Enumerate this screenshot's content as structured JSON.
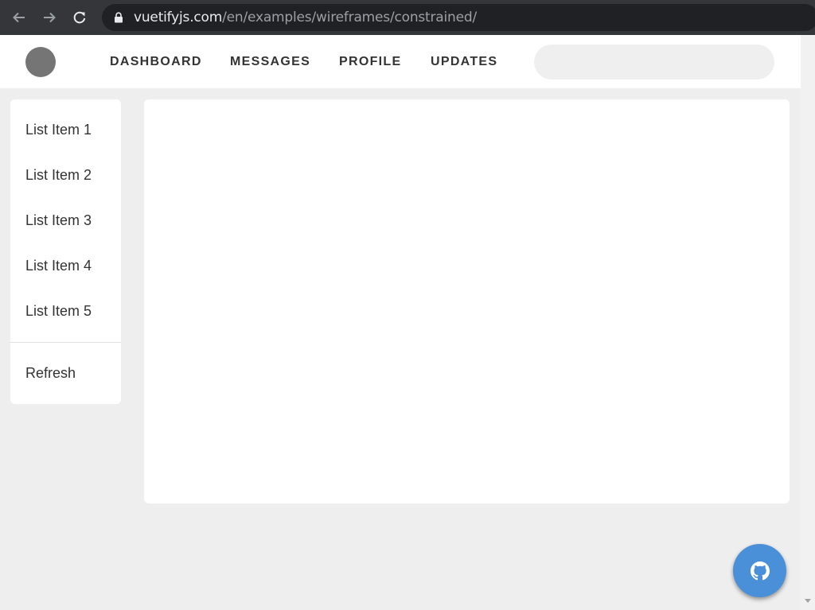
{
  "browser": {
    "url_host": "vuetifyjs.com",
    "url_path": "/en/examples/wireframes/constrained/",
    "icons": {
      "back": "arrow-left-icon",
      "forward": "arrow-right-icon",
      "reload": "reload-icon",
      "lock": "lock-icon"
    }
  },
  "app_bar": {
    "tabs": [
      {
        "label": "DASHBOARD"
      },
      {
        "label": "MESSAGES"
      },
      {
        "label": "PROFILE"
      },
      {
        "label": "UPDATES"
      }
    ],
    "search": {
      "value": "",
      "placeholder": ""
    }
  },
  "sidebar": {
    "items": [
      {
        "label": "List Item 1"
      },
      {
        "label": "List Item 2"
      },
      {
        "label": "List Item 3"
      },
      {
        "label": "List Item 4"
      },
      {
        "label": "List Item 5"
      }
    ],
    "refresh_label": "Refresh"
  },
  "fab": {
    "icon": "github-icon"
  },
  "colors": {
    "fab": "#4a90d9",
    "avatar": "#757575",
    "background": "#eeeeee"
  }
}
